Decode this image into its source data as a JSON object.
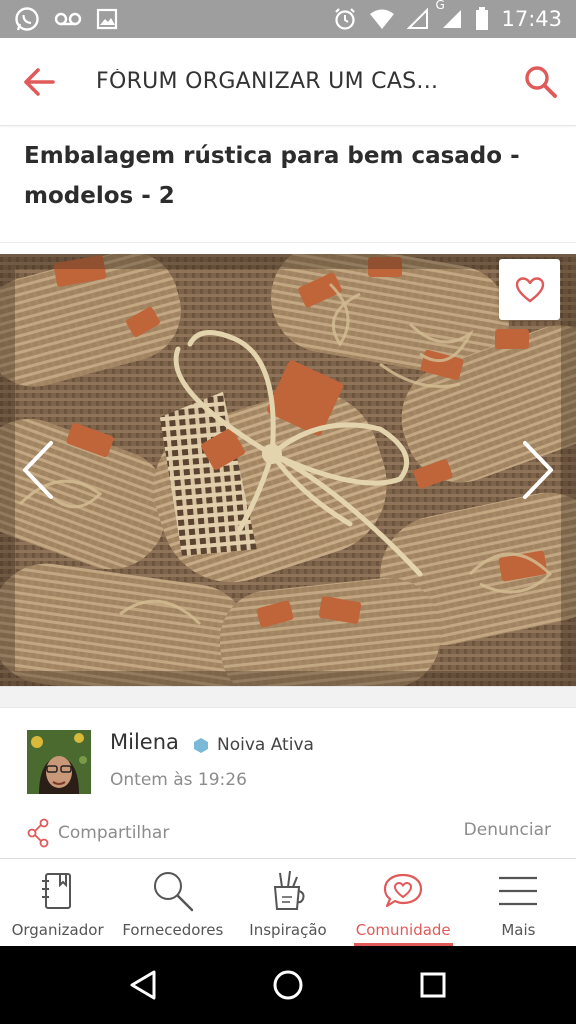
{
  "status_bar": {
    "time": "17:43",
    "icons": [
      "whatsapp-icon",
      "voicemail-icon",
      "image-icon",
      "alarm-icon",
      "wifi-icon",
      "signal-empty-icon",
      "signal-icon",
      "battery-icon"
    ],
    "network_letter": "G"
  },
  "app_bar": {
    "title": "FÓRUM ORGANIZAR UM CAS...",
    "back_icon": "arrow-left-icon",
    "search_icon": "search-icon",
    "accent_color": "#e05a5a"
  },
  "post": {
    "title": "Embalagem rústica para bem casado - modelos - 2",
    "photo_description_icon": "image",
    "favorite_icon": "heart-outline-icon",
    "prev_icon": "chevron-left-icon",
    "next_icon": "chevron-right-icon"
  },
  "author": {
    "name": "Milena",
    "badge_label": "Noiva Ativa",
    "badge_color": "#7ab8d8",
    "date": "Ontem às 19:26"
  },
  "actions": {
    "share_label": "Compartilhar",
    "report_label": "Denunciar"
  },
  "bottom_nav": {
    "items": [
      {
        "label": "Organizador",
        "icon": "notebook-icon",
        "active": false
      },
      {
        "label": "Fornecedores",
        "icon": "search-icon",
        "active": false
      },
      {
        "label": "Inspiração",
        "icon": "pencil-cup-icon",
        "active": false
      },
      {
        "label": "Comunidade",
        "icon": "heart-chat-icon",
        "active": true
      },
      {
        "label": "Mais",
        "icon": "hamburger-icon",
        "active": false
      }
    ],
    "active_color": "#e05a5a"
  },
  "system_nav": {
    "icons": [
      "back-triangle-icon",
      "home-circle-icon",
      "recents-square-icon"
    ]
  }
}
